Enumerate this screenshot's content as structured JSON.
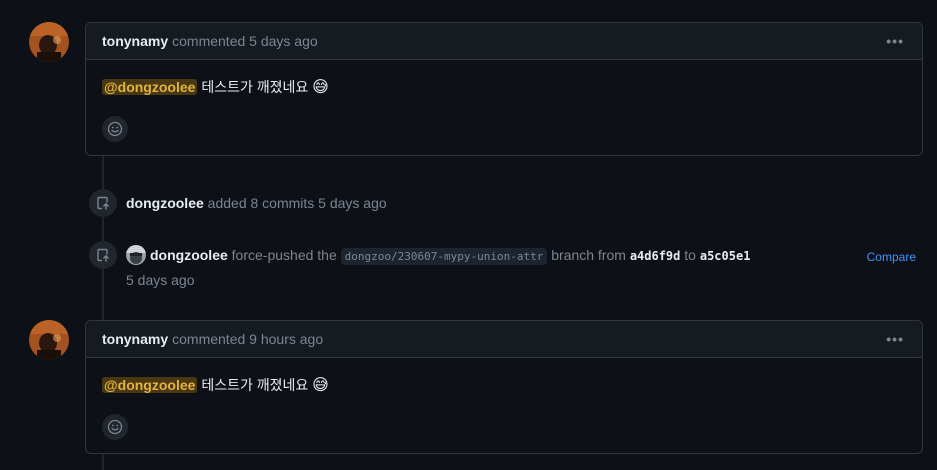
{
  "comments": [
    {
      "author": "tonynamy",
      "meta": "commented 5 days ago",
      "mention": "@dongzoolee",
      "text": "테스트가 깨졌네요",
      "emoji": "😅"
    },
    {
      "author": "tonynamy",
      "meta": "commented 9 hours ago",
      "mention": "@dongzoolee",
      "text": "테스트가 깨졌네요",
      "emoji": "😅"
    }
  ],
  "events": {
    "commits": {
      "author": "dongzoolee",
      "text": "added 8 commits 5 days ago"
    },
    "force_push": {
      "author": "dongzoolee",
      "action": "force-pushed the",
      "branch": "dongzoo/230607-mypy-union-attr",
      "branch_suffix": "branch from",
      "from_sha": "a4d6f9d",
      "to_word": "to",
      "to_sha": "a5c05e1",
      "time": "5 days ago",
      "compare_label": "Compare"
    }
  },
  "icons": {
    "kebab": "kebab-horizontal-icon",
    "reaction": "smiley-icon",
    "event": "repo-push-icon"
  },
  "colors": {
    "background": "#0d1117",
    "accent": "#4493f8",
    "mention_bg": "#bb8009"
  }
}
